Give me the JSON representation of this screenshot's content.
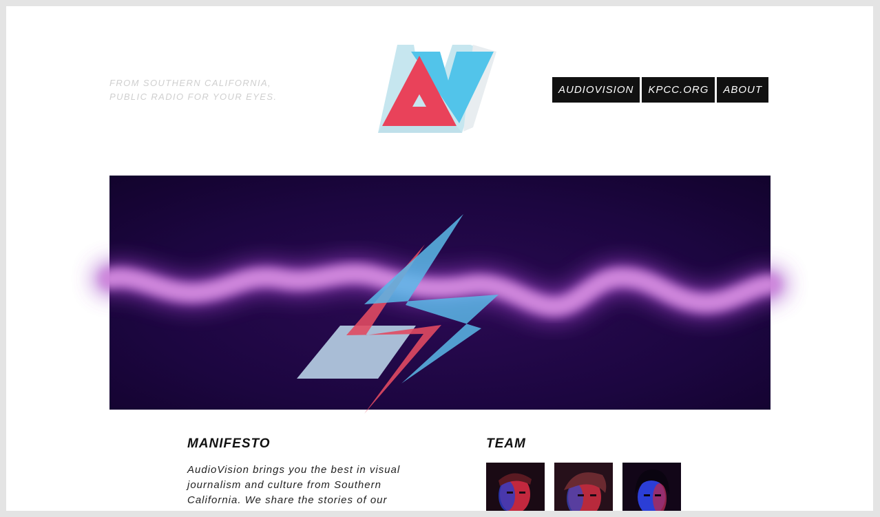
{
  "header": {
    "tagline_line1": "FROM SOUTHERN CALIFORNIA,",
    "tagline_line2": "PUBLIC RADIO FOR YOUR EYES.",
    "logo_icon": "av-logo-icon",
    "nav": [
      "AUDIOVISION",
      "KPCC.ORG",
      "ABOUT"
    ]
  },
  "hero": {
    "icon": "lightning-bolt-icon",
    "colors": {
      "background": "#1a0538",
      "wave": "#c47fd6",
      "bolt_red": "#e04a62",
      "bolt_blue": "#5ab8e8",
      "bolt_pale": "#a9bdd6"
    }
  },
  "manifesto": {
    "heading": "MANIFESTO",
    "lines": [
      "AudioVision brings you the best in visual",
      "journalism and culture from Southern",
      "California. We share the stories of our"
    ]
  },
  "team": {
    "heading": "TEAM",
    "photos": [
      "team-member-photo-1",
      "team-member-photo-2",
      "team-member-photo-3"
    ]
  },
  "brand_colors": {
    "red": "#e9425a",
    "blue": "#52c4ea",
    "pale_blue": "#c6e6ef",
    "nav_bg": "#111111"
  }
}
